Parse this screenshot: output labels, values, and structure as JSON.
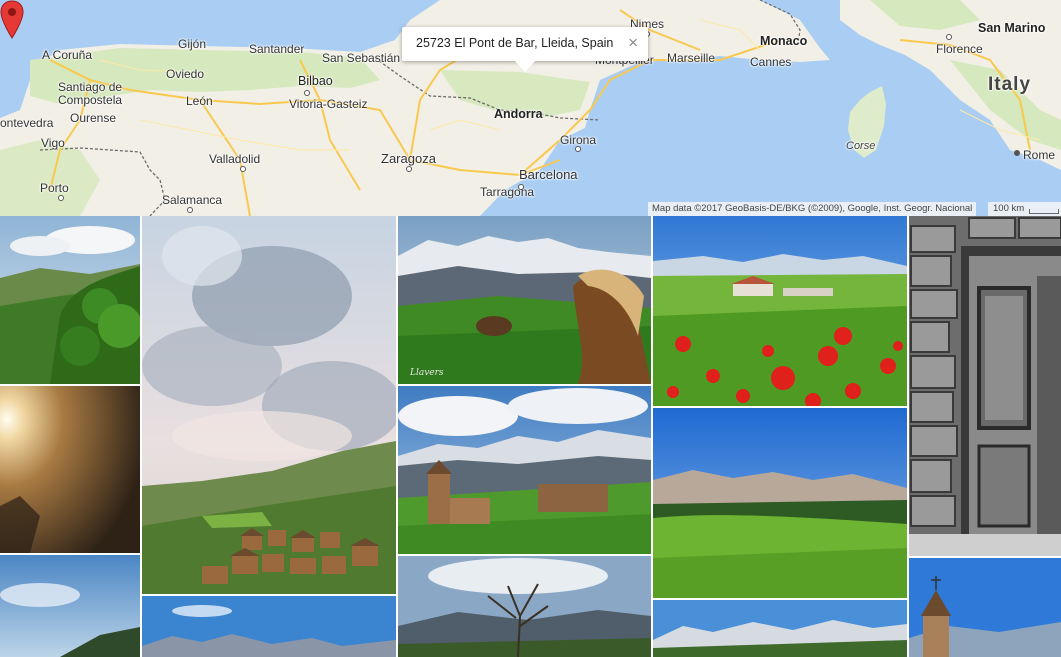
{
  "map": {
    "cities": {
      "nimes": "Nimes",
      "monaco": "Monaco",
      "marseille": "Marseille",
      "cannes": "Cannes",
      "montpellier": "Montpellier",
      "san_marino": "San Marino",
      "florence": "Florence",
      "italy": "Italy",
      "corse": "Corse",
      "rome": "Rome",
      "a_coruna": "A Coruña",
      "gijon": "Gijón",
      "santander": "Santander",
      "san_sebastian": "San Sebastián",
      "oviedo": "Oviedo",
      "bilbao": "Bilbao",
      "santiago": "Santiago de\nCompostela",
      "leon": "León",
      "vitoria": "Vitoria-Gasteiz",
      "pontevedra": "ontevedra",
      "ourense": "Ourense",
      "vigo": "Vigo",
      "andorra": "Andorra",
      "girona": "Girona",
      "valladolid": "Valladolid",
      "zaragoza": "Zaragoza",
      "barcelona": "Barcelona",
      "tarragona": "Tarragona",
      "porto": "Porto",
      "salamanca": "Salamanca"
    },
    "info_window": {
      "address": "25723 El Pont de Bar, Lleida, Spain",
      "close_glyph": "×"
    },
    "attribution": "Map data ©2017 GeoBasis-DE/BKG (©2009), Google, Inst. Geogr. Nacional",
    "scale_label": "100 km",
    "colors": {
      "sea": "#a9cdf3",
      "land": "#f2efe6",
      "green_land": "#cfe6b5",
      "road": "#f9c94f",
      "border": "#6b6b6b",
      "marker": "#e53935"
    }
  },
  "gallery": {
    "signature": "Llavers"
  }
}
